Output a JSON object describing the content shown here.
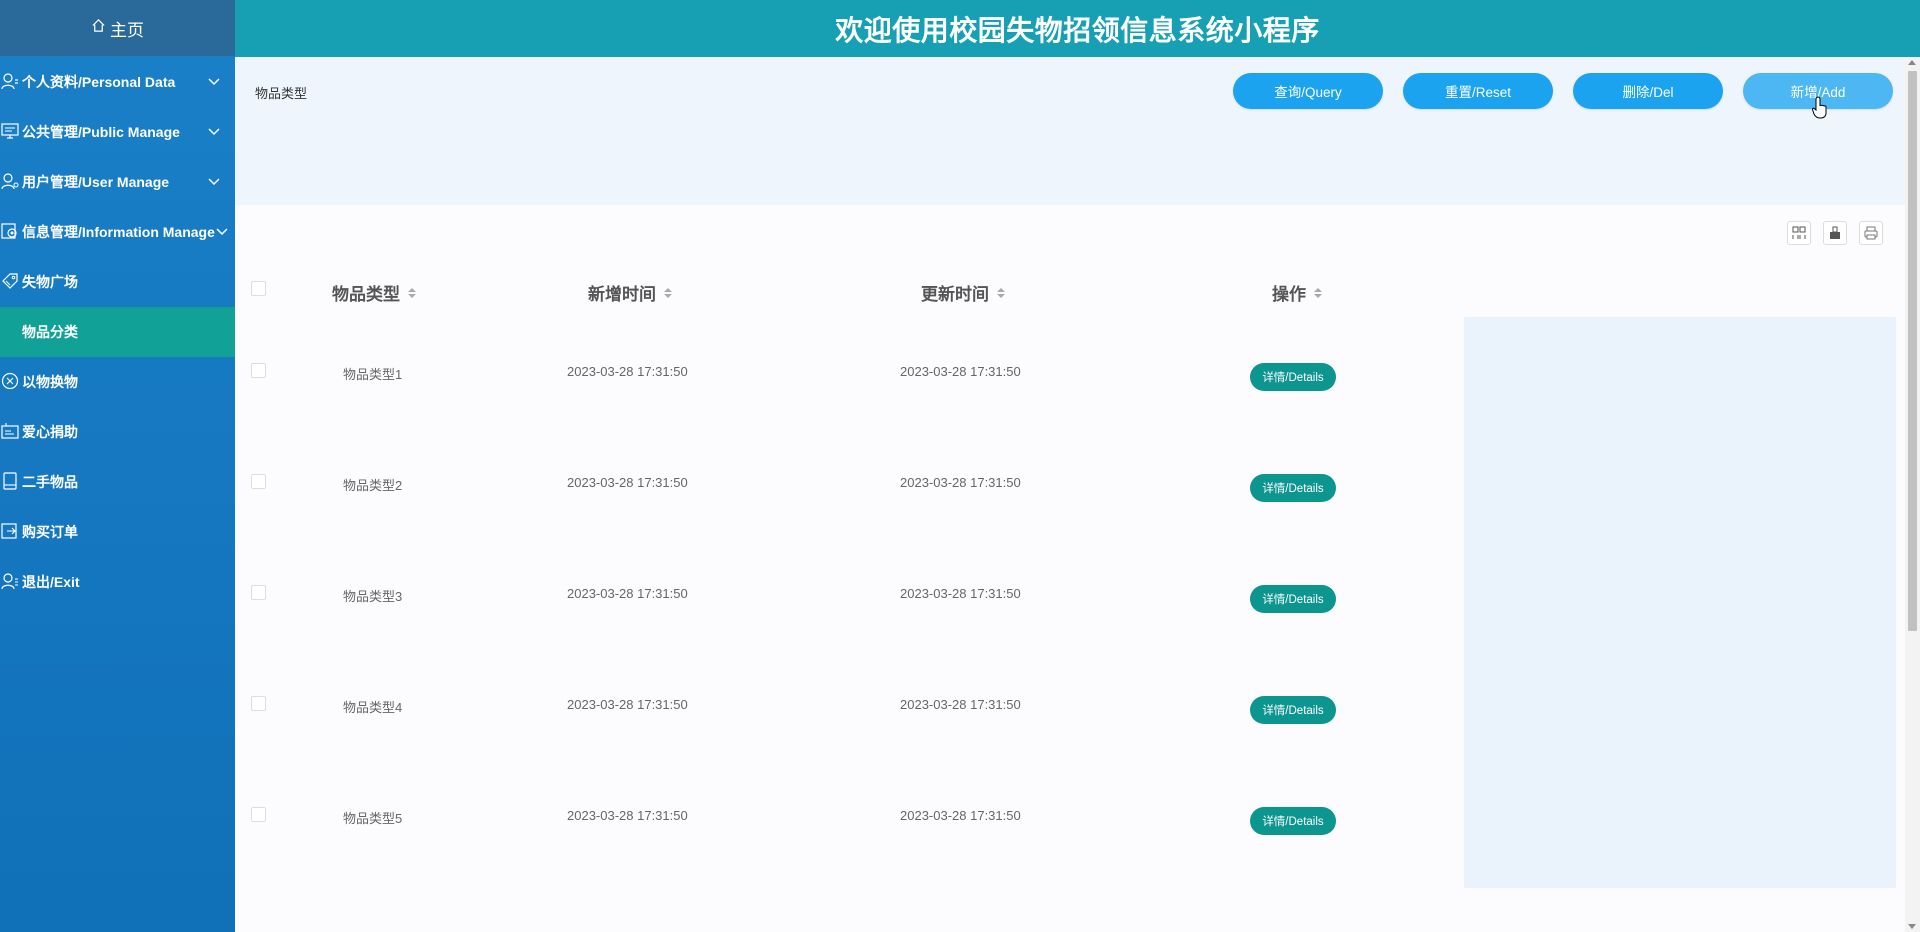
{
  "app": {
    "title": "欢迎使用校园失物招领信息系统小程序"
  },
  "sidebar": {
    "home": "主页",
    "items": [
      {
        "label": "个人资料/Personal Data",
        "icon": "user-icon",
        "expandable": true
      },
      {
        "label": "公共管理/Public Manage",
        "icon": "monitor-icon",
        "expandable": true
      },
      {
        "label": "用户管理/User Manage",
        "icon": "user-icon",
        "expandable": true
      },
      {
        "label": "信息管理/Information Manage",
        "icon": "settings-icon",
        "expandable": true
      },
      {
        "label": "失物广场",
        "icon": "tag-icon",
        "expandable": false
      },
      {
        "label": "物品分类",
        "icon": "",
        "expandable": false,
        "active": true
      },
      {
        "label": "以物换物",
        "icon": "exchange-icon",
        "expandable": false
      },
      {
        "label": "爱心捐助",
        "icon": "donate-icon",
        "expandable": false
      },
      {
        "label": "二手物品",
        "icon": "book-icon",
        "expandable": false
      },
      {
        "label": "购买订单",
        "icon": "order-icon",
        "expandable": false
      },
      {
        "label": "退出/Exit",
        "icon": "exit-icon",
        "expandable": false
      }
    ]
  },
  "search": {
    "field_label": "物品类型",
    "buttons": {
      "query": "查询/Query",
      "reset": "重置/Reset",
      "delete": "删除/Del",
      "add": "新增/Add"
    }
  },
  "table": {
    "columns": [
      "物品类型",
      "新增时间",
      "更新时间",
      "操作"
    ],
    "rows": [
      {
        "type": "物品类型1",
        "created": "2023-03-28 17:31:50",
        "updated": "2023-03-28 17:31:50",
        "action": "详情/Details"
      },
      {
        "type": "物品类型2",
        "created": "2023-03-28 17:31:50",
        "updated": "2023-03-28 17:31:50",
        "action": "详情/Details"
      },
      {
        "type": "物品类型3",
        "created": "2023-03-28 17:31:50",
        "updated": "2023-03-28 17:31:50",
        "action": "详情/Details"
      },
      {
        "type": "物品类型4",
        "created": "2023-03-28 17:31:50",
        "updated": "2023-03-28 17:31:50",
        "action": "详情/Details"
      },
      {
        "type": "物品类型5",
        "created": "2023-03-28 17:31:50",
        "updated": "2023-03-28 17:31:50",
        "action": "详情/Details"
      }
    ],
    "toolbar_icons": [
      "columns-icon",
      "export-icon",
      "print-icon"
    ]
  },
  "colors": {
    "sidebar": "#1478c0",
    "active_menu": "#12a197",
    "topbar": "#17a0b4",
    "primary_button": "#1ba3f0",
    "detail_button": "#0d958f"
  }
}
